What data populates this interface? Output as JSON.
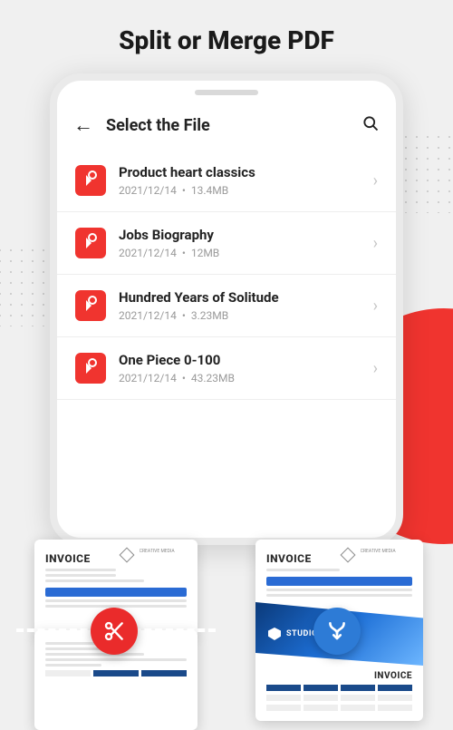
{
  "page_title": "Split or Merge PDF",
  "header": {
    "title": "Select the File"
  },
  "files": [
    {
      "name": "Product heart classics",
      "date": "2021/12/14",
      "size": "13.4MB"
    },
    {
      "name": "Jobs Biography",
      "date": "2021/12/14",
      "size": "12MB"
    },
    {
      "name": "Hundred Years of Solitude",
      "date": "2021/12/14",
      "size": "3.23MB"
    },
    {
      "name": "One Piece 0-100",
      "date": "2021/12/14",
      "size": "43.23MB"
    }
  ],
  "preview": {
    "doc_heading": "INVOICE",
    "brand_label": "CREATIVE MEDIA",
    "hero_label": "STUDIO DESIGN"
  },
  "icons": {
    "split": "cut-icon",
    "merge": "merge-icon"
  },
  "colors": {
    "accent_red": "#f0342f",
    "accent_blue": "#2d7bd6"
  }
}
